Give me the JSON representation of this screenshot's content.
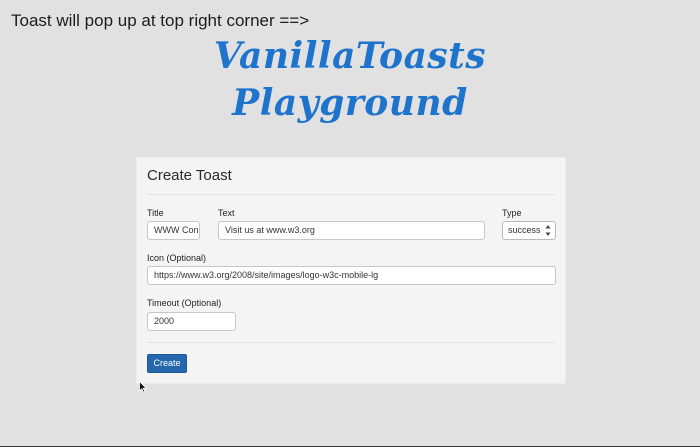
{
  "page": {
    "hint_text": "Toast will pop up at top right corner ==>",
    "logo_line1": "VanillaToasts",
    "logo_line2": "Playground"
  },
  "form": {
    "heading": "Create Toast",
    "title_label": "Title",
    "title_value": "WWW Con",
    "text_label": "Text",
    "text_value": "Visit us at www.w3.org",
    "type_label": "Type",
    "type_value": "success",
    "icon_label": "Icon (Optional)",
    "icon_value": "https://www.w3.org/2008/site/images/logo-w3c-mobile-lg",
    "timeout_label": "Timeout (Optional)",
    "timeout_value": "2000",
    "create_button": "Create"
  },
  "colors": {
    "background": "#e1e1e1",
    "brand_blue": "#1e73cc",
    "button_blue": "#2467ad",
    "card_bg": "#f4f4f4"
  },
  "icons": {
    "cursor": "arrow-cursor-icon",
    "select_arrows": "up-down-arrows-icon"
  }
}
